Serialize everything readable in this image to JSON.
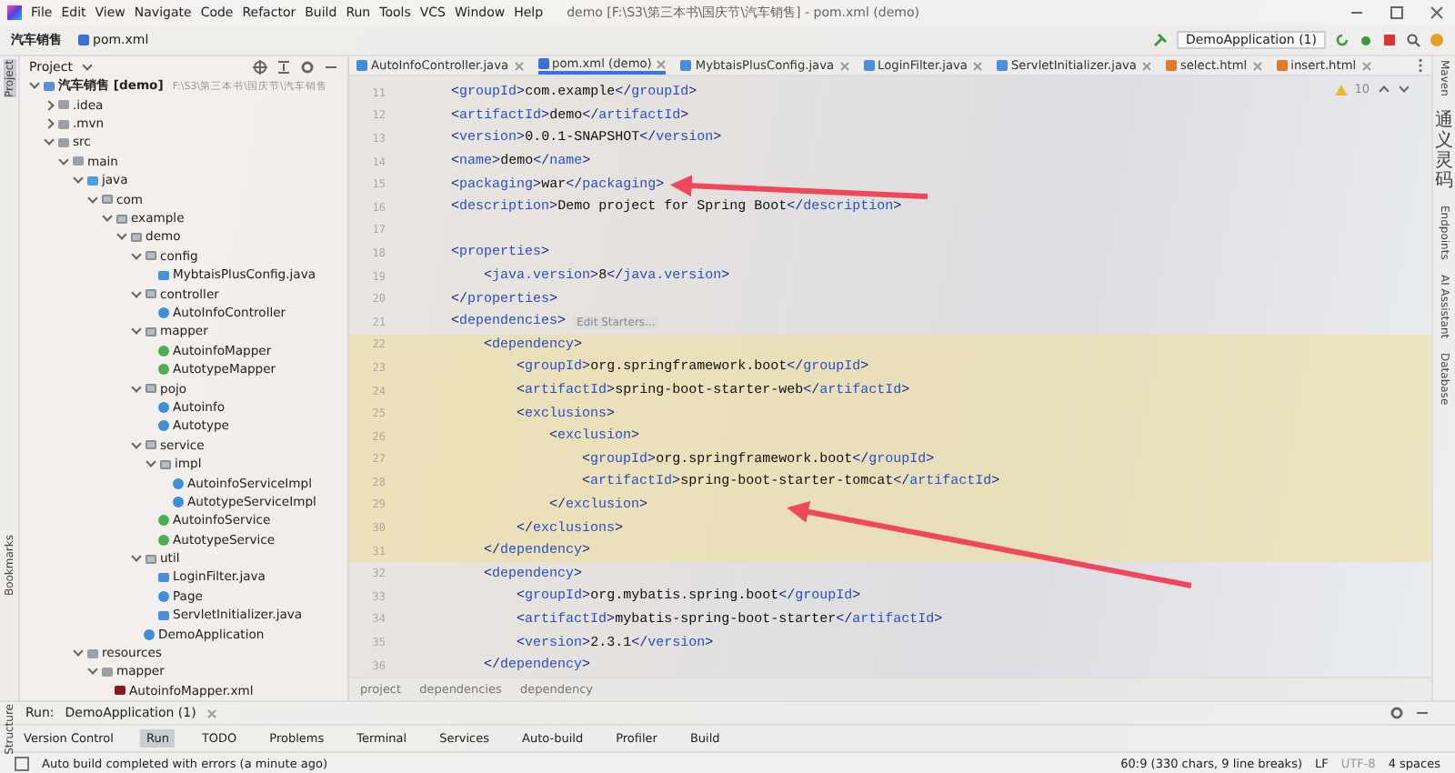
{
  "window": {
    "title": "demo [F:\\S3\\第三本书\\国庆节\\汽车销售] - pom.xml (demo)"
  },
  "menu": [
    "File",
    "Edit",
    "View",
    "Navigate",
    "Code",
    "Refactor",
    "Build",
    "Run",
    "Tools",
    "VCS",
    "Window",
    "Help"
  ],
  "navbar": {
    "project": "汽车销售",
    "file": "pom.xml",
    "run_config": "DemoApplication (1)"
  },
  "left_stripe": [
    {
      "label": "Project",
      "selected": true
    },
    {
      "label": "Bookmarks",
      "selected": false
    },
    {
      "label": "Structure",
      "selected": false
    }
  ],
  "project_panel": {
    "title": "Project",
    "tree": [
      {
        "label": "汽车销售 [demo]",
        "path": "F:\\S3\\第三本书\\国庆节\\汽车销售",
        "kind": "module",
        "expanded": true,
        "children": [
          {
            "label": ".idea",
            "kind": "folder",
            "expanded": false
          },
          {
            "label": ".mvn",
            "kind": "folder",
            "expanded": false
          },
          {
            "label": "src",
            "kind": "folder",
            "expanded": true,
            "children": [
              {
                "label": "main",
                "kind": "folder",
                "expanded": true,
                "children": [
                  {
                    "label": "java",
                    "kind": "source",
                    "expanded": true,
                    "children": [
                      {
                        "label": "com",
                        "kind": "package",
                        "expanded": true,
                        "children": [
                          {
                            "label": "example",
                            "kind": "package",
                            "expanded": true,
                            "children": [
                              {
                                "label": "demo",
                                "kind": "package",
                                "expanded": true,
                                "children": [
                                  {
                                    "label": "config",
                                    "kind": "package",
                                    "expanded": true,
                                    "children": [
                                      {
                                        "label": "MybtaisPlusConfig.java",
                                        "kind": "file"
                                      }
                                    ]
                                  },
                                  {
                                    "label": "controller",
                                    "kind": "package",
                                    "expanded": true,
                                    "children": [
                                      {
                                        "label": "AutoInfoController",
                                        "kind": "class"
                                      }
                                    ]
                                  },
                                  {
                                    "label": "mapper",
                                    "kind": "package",
                                    "expanded": true,
                                    "children": [
                                      {
                                        "label": "AutoinfoMapper",
                                        "kind": "interface"
                                      },
                                      {
                                        "label": "AutotypeMapper",
                                        "kind": "interface"
                                      }
                                    ]
                                  },
                                  {
                                    "label": "pojo",
                                    "kind": "package",
                                    "expanded": true,
                                    "children": [
                                      {
                                        "label": "Autoinfo",
                                        "kind": "class"
                                      },
                                      {
                                        "label": "Autotype",
                                        "kind": "class"
                                      }
                                    ]
                                  },
                                  {
                                    "label": "service",
                                    "kind": "package",
                                    "expanded": true,
                                    "children": [
                                      {
                                        "label": "impl",
                                        "kind": "package",
                                        "expanded": true,
                                        "children": [
                                          {
                                            "label": "AutoinfoServiceImpl",
                                            "kind": "class"
                                          },
                                          {
                                            "label": "AutotypeServiceImpl",
                                            "kind": "class"
                                          }
                                        ]
                                      },
                                      {
                                        "label": "AutoinfoService",
                                        "kind": "interface"
                                      },
                                      {
                                        "label": "AutotypeService",
                                        "kind": "interface"
                                      }
                                    ]
                                  },
                                  {
                                    "label": "util",
                                    "kind": "package",
                                    "expanded": true,
                                    "children": [
                                      {
                                        "label": "LoginFilter.java",
                                        "kind": "file"
                                      },
                                      {
                                        "label": "Page",
                                        "kind": "class"
                                      },
                                      {
                                        "label": "ServletInitializer.java",
                                        "kind": "file"
                                      }
                                    ]
                                  },
                                  {
                                    "label": "DemoApplication",
                                    "kind": "class"
                                  }
                                ]
                              }
                            ]
                          }
                        ]
                      }
                    ]
                  },
                  {
                    "label": "resources",
                    "kind": "folder",
                    "expanded": true,
                    "children": [
                      {
                        "label": "mapper",
                        "kind": "folder",
                        "expanded": true,
                        "children": [
                          {
                            "label": "AutoinfoMapper.xml",
                            "kind": "xml"
                          }
                        ]
                      }
                    ]
                  }
                ]
              }
            ]
          }
        ]
      }
    ]
  },
  "tabs": [
    {
      "label": "AutoInfoController.java",
      "kind": "class",
      "selected": false
    },
    {
      "label": "pom.xml (demo)",
      "kind": "maven",
      "selected": true
    },
    {
      "label": "MybtaisPlusConfig.java",
      "kind": "file",
      "selected": false
    },
    {
      "label": "LoginFilter.java",
      "kind": "file",
      "selected": false
    },
    {
      "label": "ServletInitializer.java",
      "kind": "file",
      "selected": false
    },
    {
      "label": "select.html",
      "kind": "html",
      "selected": false
    },
    {
      "label": "insert.html",
      "kind": "html",
      "selected": false
    }
  ],
  "editor": {
    "warnings": "10",
    "lines": [
      {
        "number": "11",
        "text": "    <groupId>com.example</groupId>",
        "highlighted": false
      },
      {
        "number": "12",
        "text": "    <artifactId>demo</artifactId>",
        "highlighted": false
      },
      {
        "number": "13",
        "text": "    <version>0.0.1-SNAPSHOT</version>",
        "highlighted": false
      },
      {
        "number": "14",
        "text": "    <name>demo</name>",
        "highlighted": false
      },
      {
        "number": "15",
        "text": "    <packaging>war</packaging>",
        "highlighted": false
      },
      {
        "number": "16",
        "text": "    <description>Demo project for Spring Boot</description>",
        "highlighted": false
      },
      {
        "number": "17",
        "highlighted": false
      },
      {
        "number": "18",
        "text": "    <properties>",
        "highlighted": false
      },
      {
        "number": "19",
        "text": "        <java.version>8</java.version>",
        "highlighted": false
      },
      {
        "number": "20",
        "text": "    </properties>",
        "highlighted": false
      },
      {
        "number": "21",
        "text": "    <dependencies>",
        "hint": "Edit Starters...",
        "highlighted": false
      },
      {
        "number": "22",
        "text": "        <dependency>",
        "highlighted": true
      },
      {
        "number": "23",
        "text": "            <groupId>org.springframework.boot</groupId>",
        "highlighted": true
      },
      {
        "number": "24",
        "text": "            <artifactId>spring-boot-starter-web</artifactId>",
        "highlighted": true
      },
      {
        "number": "25",
        "text": "            <exclusions>",
        "highlighted": true
      },
      {
        "number": "26",
        "text": "                <exclusion>",
        "highlighted": true
      },
      {
        "number": "27",
        "text": "                    <groupId>org.springframework.boot</groupId>",
        "highlighted": true
      },
      {
        "number": "28",
        "text": "                    <artifactId>spring-boot-starter-tomcat</artifactId>",
        "highlighted": true
      },
      {
        "number": "29",
        "text": "                </exclusion>",
        "highlighted": true
      },
      {
        "number": "30",
        "text": "            </exclusions>",
        "highlighted": true
      },
      {
        "number": "31",
        "text": "        </dependency>",
        "highlighted": true
      },
      {
        "number": "32",
        "text": "        <dependency>",
        "highlighted": false
      },
      {
        "number": "33",
        "text": "            <groupId>org.mybatis.spring.boot</groupId>",
        "highlighted": false
      },
      {
        "number": "34",
        "text": "            <artifactId>mybatis-spring-boot-starter</artifactId>",
        "highlighted": false
      },
      {
        "number": "35",
        "text": "            <version>2.3.1</version>",
        "highlighted": false
      },
      {
        "number": "36",
        "text": "        </dependency>",
        "highlighted": false
      }
    ],
    "breadcrumbs": [
      "project",
      "dependencies",
      "dependency"
    ]
  },
  "right_stripe": [
    {
      "label": "Maven",
      "cjk": false
    },
    {
      "label": "通义灵码",
      "cjk": true
    },
    {
      "label": "Endpoints",
      "cjk": false
    },
    {
      "label": "AI Assistant",
      "cjk": false
    },
    {
      "label": "Database",
      "cjk": false
    }
  ],
  "run_bar": {
    "label": "Run:",
    "config": "DemoApplication (1)"
  },
  "tool_windows": [
    {
      "label": "Version Control",
      "selected": false
    },
    {
      "label": "Run",
      "selected": true
    },
    {
      "label": "TODO",
      "selected": false
    },
    {
      "label": "Problems",
      "selected": false
    },
    {
      "label": "Terminal",
      "selected": false
    },
    {
      "label": "Services",
      "selected": false
    },
    {
      "label": "Auto-build",
      "selected": false
    },
    {
      "label": "Profiler",
      "selected": false
    },
    {
      "label": "Build",
      "selected": false
    }
  ],
  "status_bar": {
    "message": "Auto build completed with errors (a minute ago)",
    "position": "60:9 (330 chars, 9 line breaks)",
    "line_ending": "LF",
    "encoding": "UTF-8",
    "indent": "4 spaces"
  }
}
